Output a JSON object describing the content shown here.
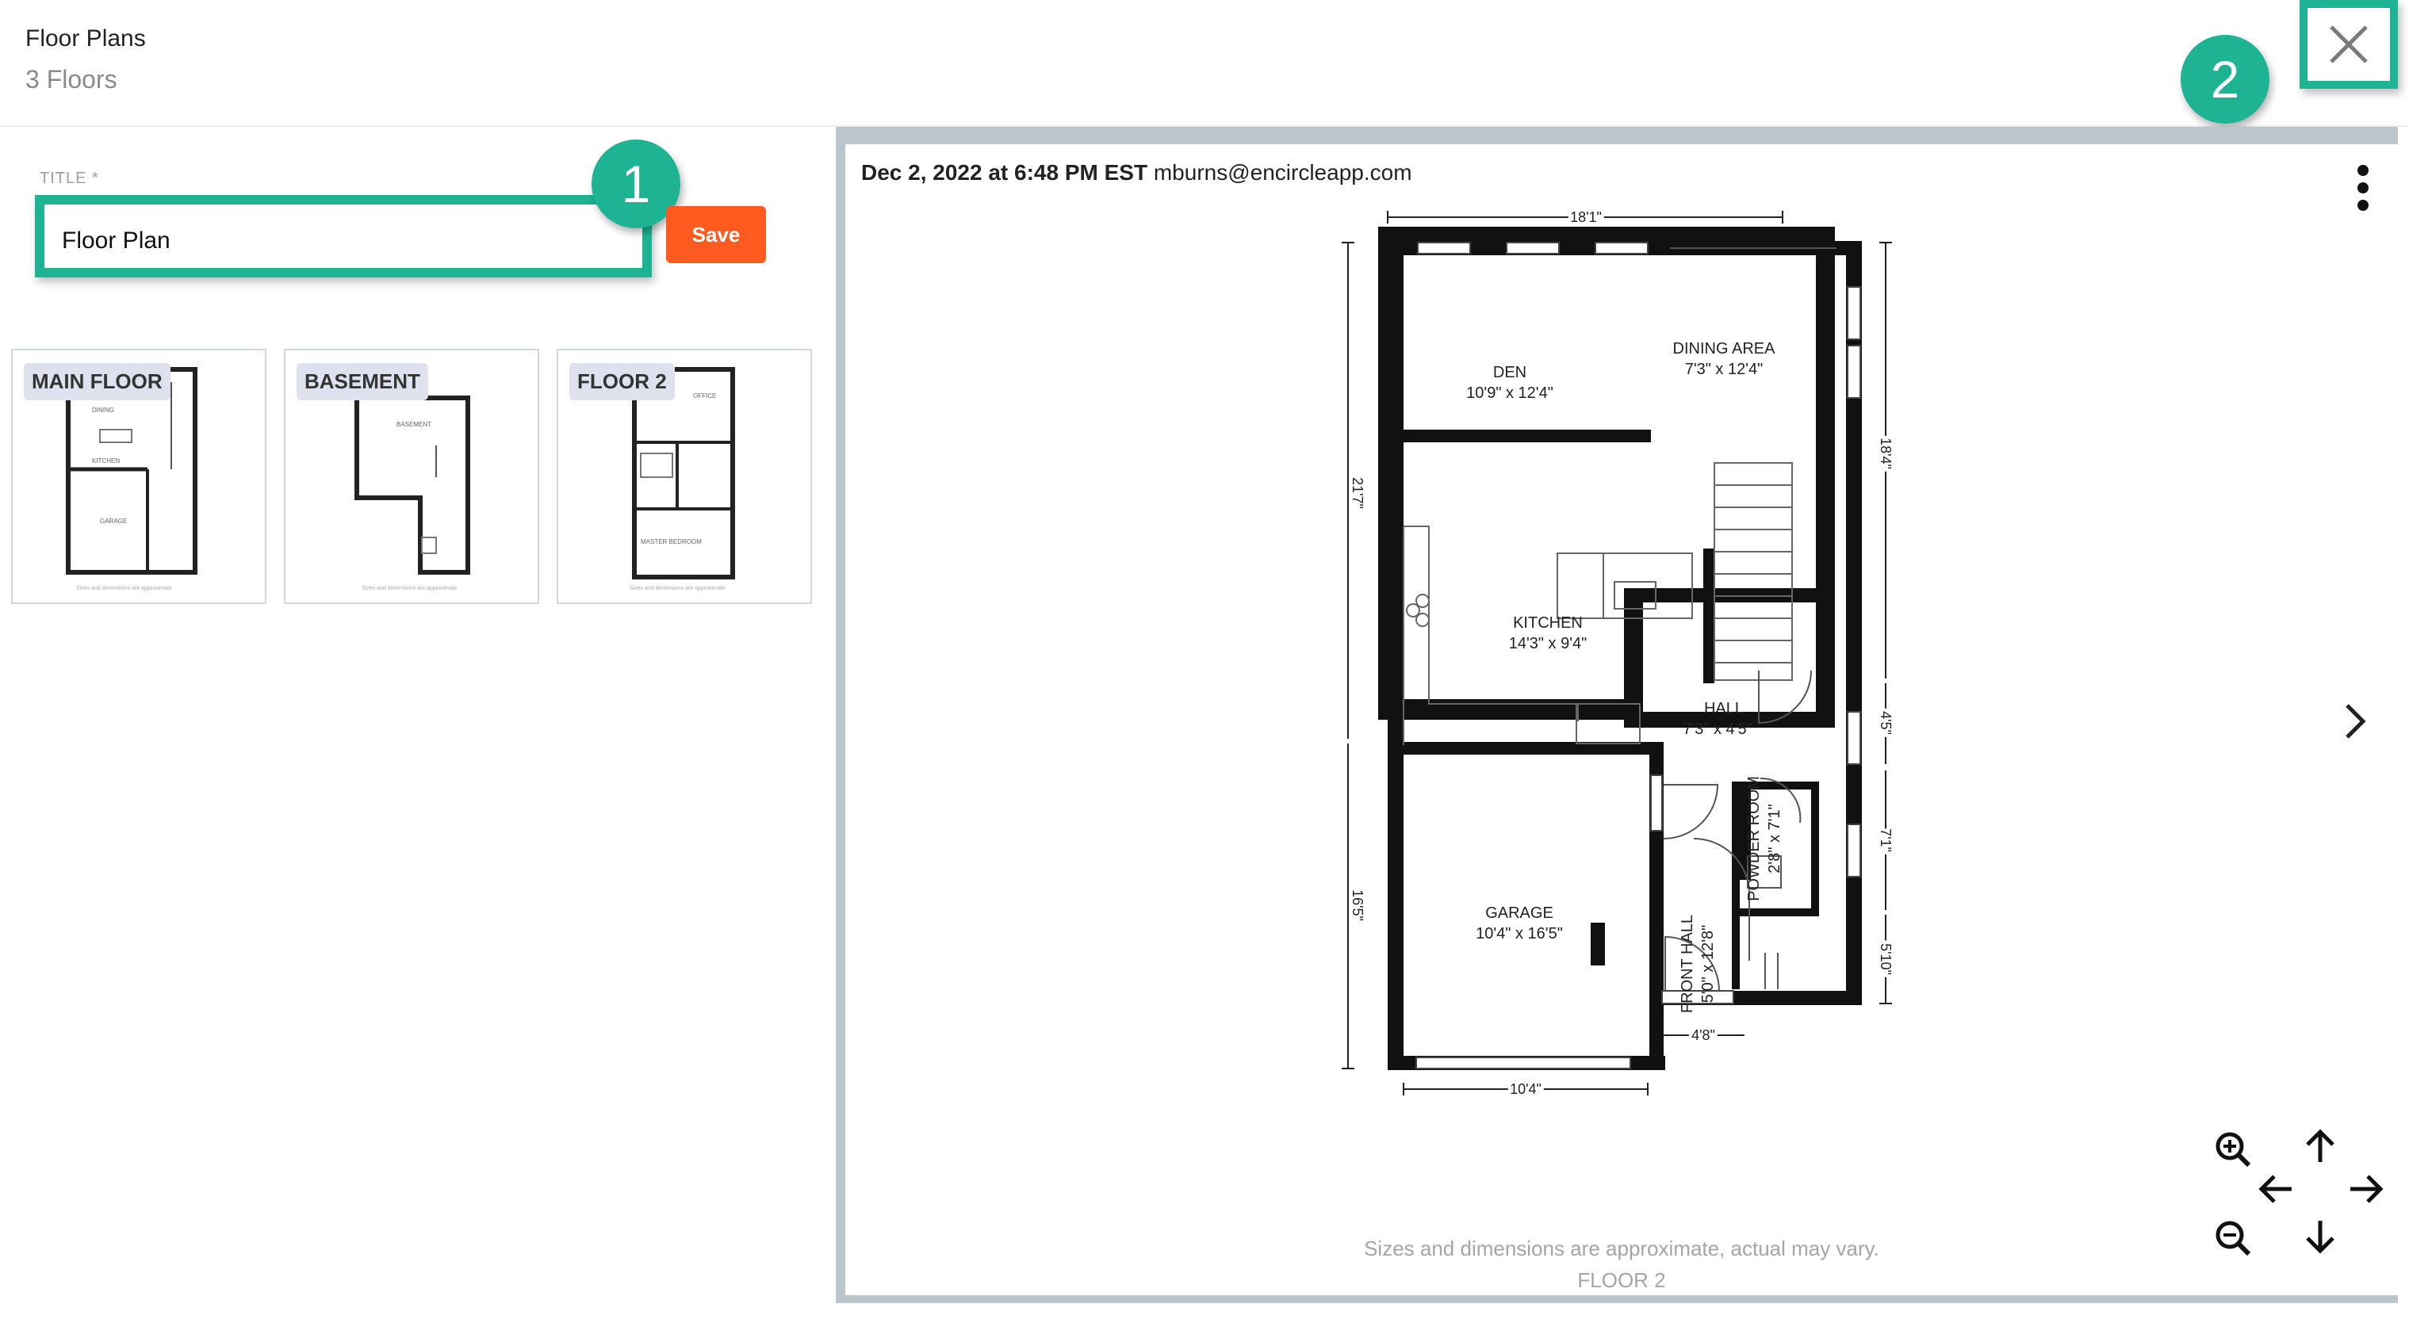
{
  "header": {
    "title": "Floor Plans",
    "subtitle": "3 Floors"
  },
  "form": {
    "title_label": "TITLE *",
    "title_value": "Floor Plan",
    "save_label": "Save"
  },
  "callouts": {
    "one": "1",
    "two": "2"
  },
  "thumbnails": [
    {
      "label": "MAIN FLOOR"
    },
    {
      "label": "BASEMENT"
    },
    {
      "label": "FLOOR 2"
    }
  ],
  "viewer": {
    "timestamp": "Dec 2, 2022 at 6:48 PM EST",
    "user": "mburns@encircleapp.com",
    "disclaimer": "Sizes and dimensions are approximate, actual may vary.",
    "floor_caption": "FLOOR 2"
  },
  "plan": {
    "rooms": [
      {
        "name": "DEN",
        "dims": "10'9\" x 12'4\""
      },
      {
        "name": "DINING AREA",
        "dims": "7'3\" x 12'4\""
      },
      {
        "name": "KITCHEN",
        "dims": "14'3\" x 9'4\""
      },
      {
        "name": "HALL",
        "dims": "7'3\" x 4'5\""
      },
      {
        "name": "GARAGE",
        "dims": "10'4\" x 16'5\""
      },
      {
        "name": "FRONT HALL",
        "dims": "5'0\" x 12'8\""
      },
      {
        "name": "POWDER ROOM",
        "dims": "2'8\" x 7'1\""
      }
    ],
    "dimensions": {
      "top": "18'1\"",
      "left_upper": "21'7\"",
      "left_lower": "16'5\"",
      "right_1": "18'4\"",
      "right_2": "4'5\"",
      "right_3": "7'1\"",
      "right_4": "5'10\"",
      "bottom_left": "10'4\"",
      "bottom_right": "4'8\""
    }
  },
  "icons": {
    "close": "close-icon",
    "kebab": "more-vertical-icon",
    "next": "chevron-right-icon",
    "zoom_in": "zoom-in-icon",
    "zoom_out": "zoom-out-icon",
    "pan": [
      "arrow-up-icon",
      "arrow-left-icon",
      "arrow-right-icon",
      "arrow-down-icon"
    ]
  },
  "colors": {
    "accent": "#1db393",
    "save": "#ff5a1f"
  }
}
